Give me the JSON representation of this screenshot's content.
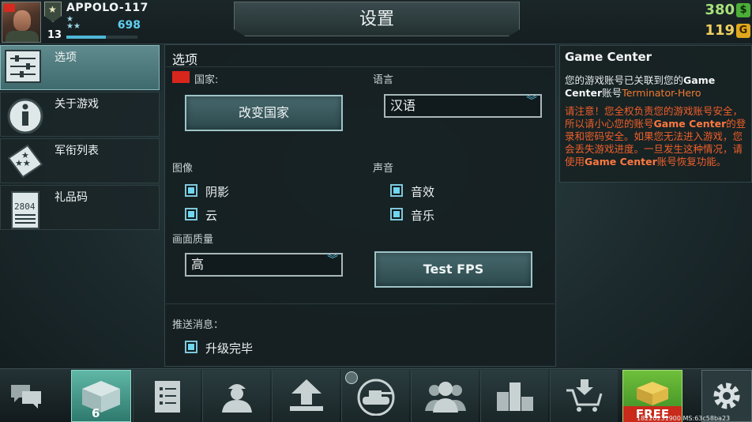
{
  "player": {
    "name": "APPOLO-117",
    "level": "13",
    "xp": "698",
    "xp_progress": 0.55
  },
  "header": {
    "title": "设置"
  },
  "currency": {
    "cash": "380",
    "cash_symbol": "$",
    "gold": "119",
    "gold_symbol": "G"
  },
  "sidebar": {
    "items": [
      {
        "label": "选项",
        "icon": "sliders-icon",
        "active": true
      },
      {
        "label": "关于游戏",
        "icon": "info-icon",
        "active": false
      },
      {
        "label": "军衔列表",
        "icon": "rank-stars-icon",
        "active": false
      },
      {
        "label": "礼品码",
        "icon": "gift-ticket-icon",
        "ticket_number": "2804",
        "active": false
      }
    ]
  },
  "options": {
    "title": "选项",
    "country_label": "国家:",
    "change_country_button": "改变国家",
    "language_label": "语言",
    "language_value": "汉语",
    "graphics_label": "图像",
    "shadow_label": "阴影",
    "shadow_checked": true,
    "clouds_label": "云",
    "clouds_checked": true,
    "sound_label": "声音",
    "sfx_label": "音效",
    "sfx_checked": true,
    "music_label": "音乐",
    "music_checked": true,
    "quality_label": "画面质量",
    "quality_value": "高",
    "test_fps_button": "Test FPS",
    "push_label": "推送消息：",
    "upgrade_done_label": "升级完毕",
    "upgrade_done_checked": true
  },
  "game_center": {
    "title": "Game Center",
    "text_prefix": "您的游戏账号已关联到您的",
    "text_service": "Game Center",
    "text_mid": "账号",
    "account": "Terminator-Hero",
    "warning_a": "请注意！您全权负责您的游戏账号安全，所以请小心您的账号",
    "warning_service": "Game Center",
    "warning_b": "的登录和密码安全。如果您无法进入游戏，您会丢失游戏进度。一旦发生这种情况，请使用",
    "warning_service2": "Game Center",
    "warning_c": "账号恢复功能。"
  },
  "bottom_nav": {
    "crate_count": "6",
    "free_label": "FREE",
    "version": "18220231900 MS:63c58ba23"
  },
  "colors": {
    "accent": "#6fd6ef",
    "cash": "#a6e07a",
    "gold": "#f0d060",
    "warning": "#ef5f2a"
  }
}
